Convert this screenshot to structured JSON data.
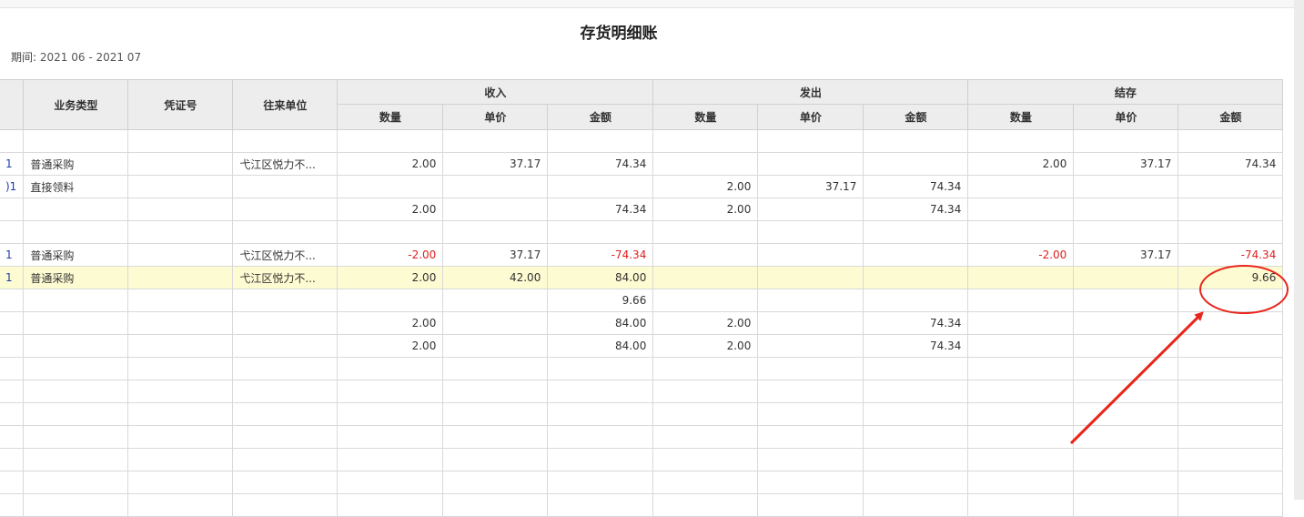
{
  "report": {
    "title": "存货明细账",
    "period_label": "期间:",
    "period_value": "2021 06 - 2021 07"
  },
  "table": {
    "headers": {
      "business_type": "业务类型",
      "voucher_no": "凭证号",
      "counterparty": "往来单位",
      "receipt": "收入",
      "issue": "发出",
      "balance": "结存",
      "qty": "数量",
      "unit_price": "单价",
      "amount": "金额"
    },
    "rows": [
      {
        "idx": "",
        "type": "",
        "voucher": "",
        "party": "",
        "in_qty": "",
        "in_price": "",
        "in_amt": "",
        "out_qty": "",
        "out_price": "",
        "out_amt": "",
        "bal_qty": "",
        "bal_price": "",
        "bal_amt": ""
      },
      {
        "idx": "1",
        "type": "普通采购",
        "voucher": "",
        "party": "弋江区悦力不...",
        "in_qty": "2.00",
        "in_price": "37.17",
        "in_amt": "74.34",
        "out_qty": "",
        "out_price": "",
        "out_amt": "",
        "bal_qty": "2.00",
        "bal_price": "37.17",
        "bal_amt": "74.34"
      },
      {
        "idx": ")1",
        "type": "直接领料",
        "voucher": "",
        "party": "",
        "in_qty": "",
        "in_price": "",
        "in_amt": "",
        "out_qty": "2.00",
        "out_price": "37.17",
        "out_amt": "74.34",
        "bal_qty": "",
        "bal_price": "",
        "bal_amt": ""
      },
      {
        "idx": "",
        "type": "",
        "voucher": "",
        "party": "",
        "in_qty": "2.00",
        "in_price": "",
        "in_amt": "74.34",
        "out_qty": "2.00",
        "out_price": "",
        "out_amt": "74.34",
        "bal_qty": "",
        "bal_price": "",
        "bal_amt": ""
      },
      {
        "idx": "",
        "type": "",
        "voucher": "",
        "party": "",
        "in_qty": "",
        "in_price": "",
        "in_amt": "",
        "out_qty": "",
        "out_price": "",
        "out_amt": "",
        "bal_qty": "",
        "bal_price": "",
        "bal_amt": ""
      },
      {
        "idx": "1",
        "type": "普通采购",
        "voucher": "",
        "party": "弋江区悦力不...",
        "in_qty": "-2.00",
        "in_price": "37.17",
        "in_amt": "-74.34",
        "out_qty": "",
        "out_price": "",
        "out_amt": "",
        "bal_qty": "-2.00",
        "bal_price": "37.17",
        "bal_amt": "-74.34"
      },
      {
        "idx": "1",
        "type": "普通采购",
        "voucher": "",
        "party": "弋江区悦力不...",
        "in_qty": "2.00",
        "in_price": "42.00",
        "in_amt": "84.00",
        "out_qty": "",
        "out_price": "",
        "out_amt": "",
        "bal_qty": "",
        "bal_price": "",
        "bal_amt": "9.66"
      },
      {
        "idx": "",
        "type": "",
        "voucher": "",
        "party": "",
        "in_qty": "",
        "in_price": "",
        "in_amt": "9.66",
        "out_qty": "",
        "out_price": "",
        "out_amt": "",
        "bal_qty": "",
        "bal_price": "",
        "bal_amt": ""
      },
      {
        "idx": "",
        "type": "",
        "voucher": "",
        "party": "",
        "in_qty": "2.00",
        "in_price": "",
        "in_amt": "84.00",
        "out_qty": "2.00",
        "out_price": "",
        "out_amt": "74.34",
        "bal_qty": "",
        "bal_price": "",
        "bal_amt": ""
      },
      {
        "idx": "",
        "type": "",
        "voucher": "",
        "party": "",
        "in_qty": "2.00",
        "in_price": "",
        "in_amt": "84.00",
        "out_qty": "2.00",
        "out_price": "",
        "out_amt": "74.34",
        "bal_qty": "",
        "bal_price": "",
        "bal_amt": ""
      }
    ],
    "highlight_row": 6,
    "negative_color": "#e02020",
    "highlight_color": "#fdfbd2"
  },
  "annotation": {
    "color": "#e8261c",
    "shapes": [
      "circle-around-cell",
      "arrow-pointing-to-cell"
    ]
  }
}
